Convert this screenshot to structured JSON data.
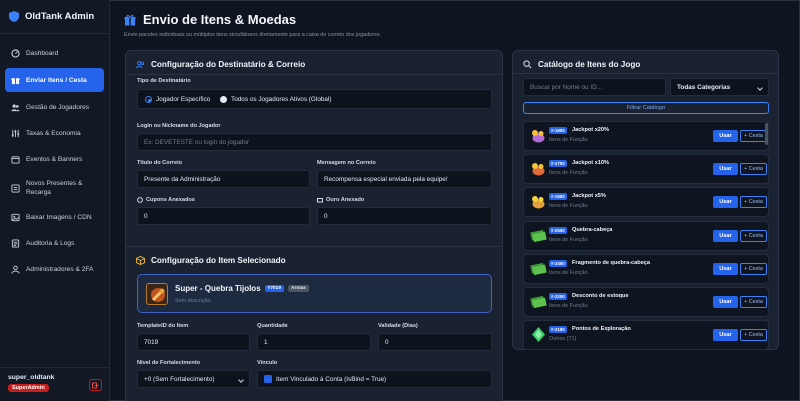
{
  "app": {
    "title": "OldTank Admin"
  },
  "sidebar": {
    "items": [
      {
        "label": "Dashboard",
        "icon": "dashboard-icon"
      },
      {
        "label": "Enviar Itens / Cesta",
        "icon": "gift-icon",
        "active": true
      },
      {
        "label": "Gestão de Jogadores",
        "icon": "users-icon"
      },
      {
        "label": "Taxas & Economia",
        "icon": "sliders-icon"
      },
      {
        "label": "Eventos & Banners",
        "icon": "calendar-icon"
      },
      {
        "label": "Novos Presentes & Recarga",
        "icon": "gift-box-icon"
      },
      {
        "label": "Baixar Imagens / CDN",
        "icon": "download-icon"
      },
      {
        "label": "Auditoria & Logs",
        "icon": "list-icon"
      },
      {
        "label": "Administradores & 2FA",
        "icon": "admin-icon"
      }
    ],
    "user": {
      "name": "super_oldtank",
      "role": "SuperAdmin"
    }
  },
  "header": {
    "title": "Envio de Itens & Moedas",
    "subtitle": "Envie pacotes individuais ou múltiplos itens simultâneos diretamente para a caixa de correio dos jogadores."
  },
  "recipient": {
    "title": "Configuração do Destinatário & Correio",
    "type_label": "Tipo de Destinatário",
    "option_specific": "Jogador Específico",
    "option_all": "Todos os Jogadores Ativos (Global)",
    "login_label": "Login ou Nickname do Jogador",
    "login_placeholder": "Ex: DEVETESTE ou login do jogador",
    "mail_title_label": "Título do Correio",
    "mail_title_value": "Presente da Administração",
    "mail_message_label": "Mensagem no Correio",
    "mail_message_value": "Recompensa especial enviada pela equipe!",
    "coupons_label": "Cupons Anexados",
    "coupons_value": "0",
    "gold_label": "Ouro Anexado",
    "gold_value": "0"
  },
  "item_config": {
    "title": "Configuração do Item Selecionado",
    "item_name": "Super - Quebra Tijolos",
    "item_id_tag": "#7019",
    "item_category_tag": "Armas",
    "item_description": "Sem descrição",
    "template_label": "TemplateID do Item",
    "template_value": "7019",
    "quantity_label": "Quantidade",
    "quantity_value": "1",
    "validity_label": "Validade (Dias)",
    "validity_value": "0",
    "strength_label": "Nível de Fortalecimento",
    "strength_value": "+0 (Sem Fortalecimento)",
    "bind_label": "Vínculo",
    "bind_value": "Item Vinculado à Conta (IsBind = True)"
  },
  "catalog": {
    "title": "Catálogo de Itens do Jogo",
    "search_placeholder": "Buscar por Nome ou ID...",
    "category_select": "Todas Categorias",
    "filter_button": "Filtrar Catálogo",
    "use_label": "Usar",
    "basket_label": "+ Cesta",
    "items": [
      {
        "id": "#-1800",
        "name": "Jackpot x20%",
        "sub": "Itens de Função",
        "icon": "coin-bag-icon"
      },
      {
        "id": "#-1700",
        "name": "Jackpot x10%",
        "sub": "Itens de Função",
        "icon": "coin-bag-icon"
      },
      {
        "id": "#-1600",
        "name": "Jackpot x5%",
        "sub": "Itens de Função",
        "icon": "coin-bag-icon"
      },
      {
        "id": "#-2500",
        "name": "Quebra-cabeça",
        "sub": "Itens de Função",
        "icon": "cash-stack-icon"
      },
      {
        "id": "#-2400",
        "name": "Fragmento de quebra-cabeça",
        "sub": "Itens de Função",
        "icon": "cash-stack-icon"
      },
      {
        "id": "#-2200",
        "name": "Desconto de estoque",
        "sub": "Itens de Função",
        "icon": "cash-stack-icon"
      },
      {
        "id": "#-2100",
        "name": "Pontos de Exploração",
        "sub": "Outros (71)",
        "icon": "green-gem-icon"
      }
    ]
  },
  "colors": {
    "accent": "#2563eb",
    "background": "#0f1520",
    "panel": "#1a2231",
    "danger": "#c81e1e"
  }
}
